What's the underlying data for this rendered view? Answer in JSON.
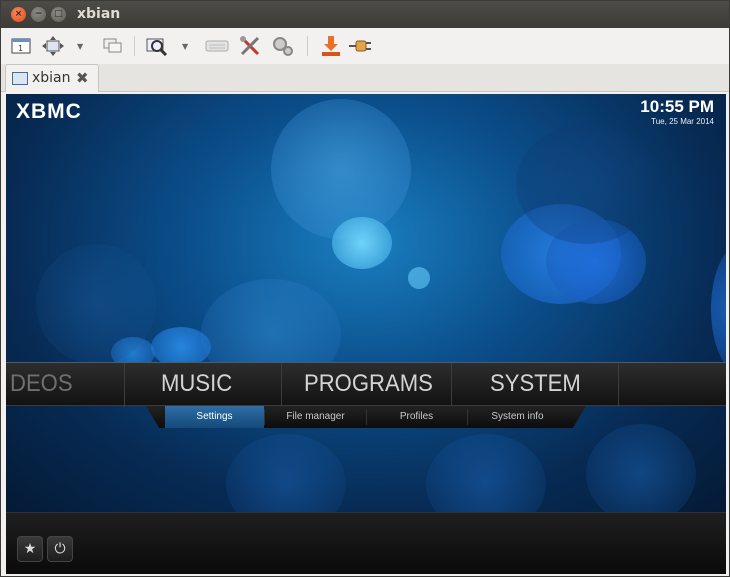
{
  "window": {
    "title": "xbian",
    "close_glyph": "×",
    "min_glyph": "−",
    "max_glyph": "□"
  },
  "tab": {
    "label": "xbian",
    "close_glyph": "✖"
  },
  "toolbar": {
    "icons": [
      "fit-window-icon",
      "resize-icon",
      "screens-icon",
      "zoom-icon",
      "keyboard-icon",
      "tools-icon",
      "preferences-icon",
      "download-icon",
      "disconnect-icon"
    ]
  },
  "xbmc": {
    "logo": "XBMC",
    "time": "10:55 PM",
    "date": "Tue, 25 Mar 2014",
    "menu": [
      "DEOS",
      "MUSIC",
      "PROGRAMS",
      "SYSTEM"
    ],
    "submenu": [
      "Settings",
      "File manager",
      "Profiles",
      "System info"
    ],
    "active_submenu": "Settings",
    "favourites_glyph": "★",
    "power_glyph": "⏻"
  },
  "colors": {
    "title_bar": "#3c3b37",
    "close_button": "#df4a16",
    "background_blue": "#0b4f8c",
    "active_submenu": "#2e6ea6"
  }
}
